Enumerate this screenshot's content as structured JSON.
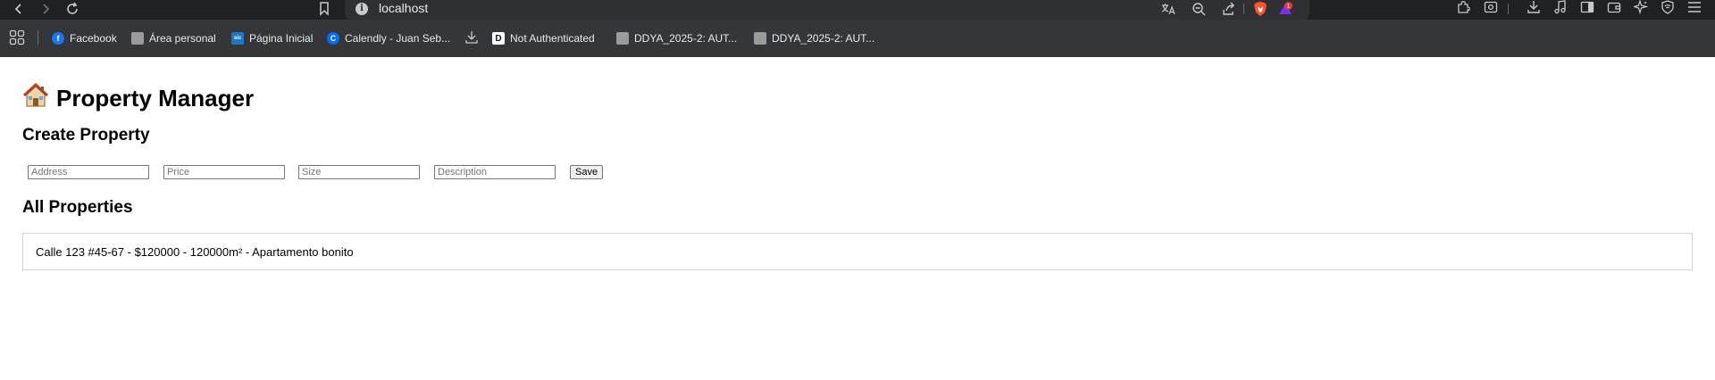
{
  "browser": {
    "url": "localhost",
    "extension_badge": "1",
    "bookmarks": [
      {
        "label": "Facebook",
        "icon": "facebook-icon",
        "color": "#1877f2"
      },
      {
        "label": "Área personal",
        "icon": "page-icon",
        "color": "#9a9a9a"
      },
      {
        "label": "Página Inicial",
        "icon": "site-icon",
        "color": "#1d78c1"
      },
      {
        "label": "Calendly - Juan Seb...",
        "icon": "calendly-icon",
        "color": "#006bff"
      },
      {
        "label": "Not Authenticated",
        "icon": "dj-icon",
        "color": "#ffffff"
      },
      {
        "label": "DDYA_2025-2: AUT...",
        "icon": "page-icon",
        "color": "#9a9a9a"
      },
      {
        "label": "DDYA_2025-2: AUT...",
        "icon": "page-icon",
        "color": "#9a9a9a"
      }
    ]
  },
  "app": {
    "icon": "house-icon",
    "title": "Property Manager",
    "create_heading": "Create Property",
    "form": {
      "address_placeholder": "Address",
      "price_placeholder": "Price",
      "size_placeholder": "Size",
      "description_placeholder": "Description",
      "save_label": "Save"
    },
    "list_heading": "All Properties",
    "properties": [
      {
        "text": "Calle 123 #45-67 - $120000 - 120000m² - Apartamento bonito"
      }
    ]
  }
}
